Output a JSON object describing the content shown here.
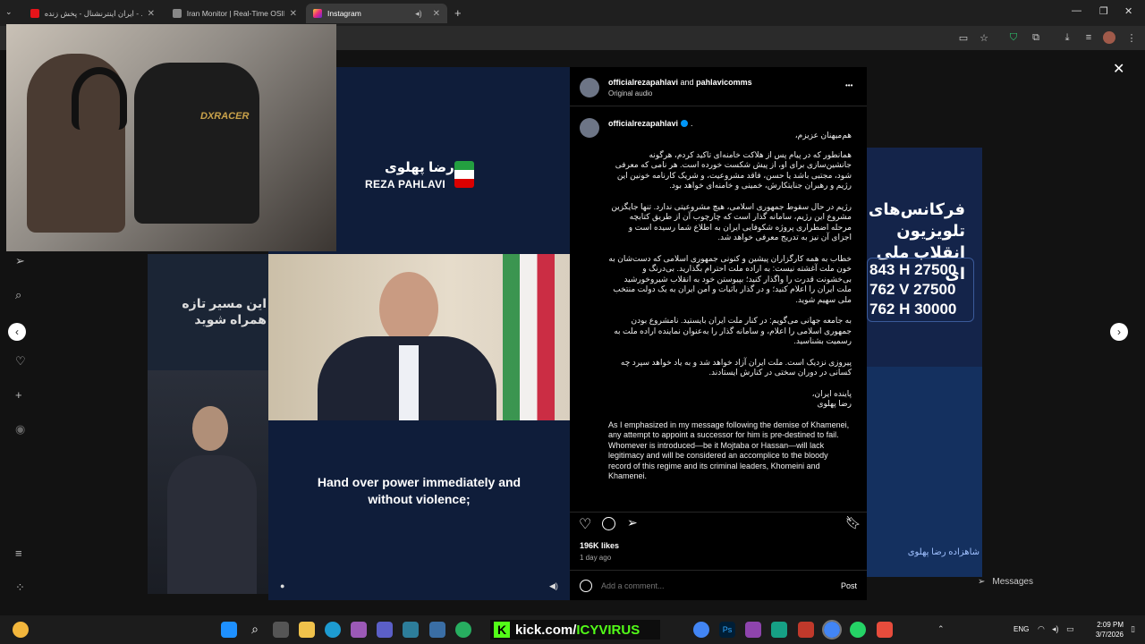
{
  "browser": {
    "tabs": [
      {
        "label": "ایران اینترنشنال - پخش زنده - ...be"
      },
      {
        "label": "Iran Monitor | Real-Time OSINT"
      },
      {
        "label": "Instagram"
      }
    ]
  },
  "video": {
    "logo_fa": "رضا پهلوی",
    "logo_en": "REZA PAHLAVI",
    "caption": "Hand over power immediately and without violence;"
  },
  "post": {
    "header": {
      "user1": "officialrezapahlavi",
      "and": "and",
      "user2": "pahlavicomms",
      "audio": "Original audio",
      "more": "•••"
    },
    "author": "officialrezapahlavi",
    "author_suffix": ".",
    "caption_fa": [
      "هم‌میهنان عزیزم،",
      "همانطور که در پیام پس از هلاکت خامنه‌ای تاکید کردم، هرگونه جانشین‌سازی برای او، از پیش شکست خورده است. هر نامی که معرفی شود، مجتبی باشد یا حسن، فاقد مشروعیت، و شریک کارنامه خونین این رژیم و رهبران جنایتکارش، خمینی و خامنه‌ای خواهد بود.",
      "رژیم در حال سقوط جمهوری اسلامی، هیچ مشروعیتی ندارد. تنها جایگزین مشروع این رژیم، سامانه گذار است که چارچوب آن از طریق کتابچه مرحله اضطراری پروژه شکوفایی ایران به اطلاع شما رسیده است و اجزای آن نیز به تدریج معرفی خواهد شد.",
      "خطاب به همه کارگزاران پیشین و کنونی جمهوری اسلامی که دست‌شان به خون ملت آغشته نیست: به اراده ملت احترام بگذارید. بی‌درنگ و بی‌خشونت قدرت را واگذار کنید؛ بپیوستن خود به انقلاب شیروخورشید ملت ایران را اعلام کنید؛ و در گذار باثبات و امن ایران به یک دولت منتخب ملی سهیم شوید.",
      "به جامعه جهانی می‌گویم: در کنار ملت ایران بایستید. نامشروع بودن جمهوری اسلامی را اعلام، و سامانه گذار را به‌عنوان نماینده اراده ملت به رسمیت بشناسید.",
      "پیروزی نزدیک است. ملت ایران آزاد خواهد شد و به یاد خواهد سپرد چه کسانی در دوران سختی در کنارش ایستادند.",
      "پاینده ایران،\nرضا پهلوی"
    ],
    "caption_en": "As I emphasized in my message following the demise of Khamenei, any attempt to appoint a successor for him is pre-destined to fail. Whomever is introduced—be it Mojtaba or Hassan—will lack legitimacy and will be considered an accomplice to the bloody record of this regime and its criminal leaders, Khomeini and Khamenei.",
    "likes": "196K likes",
    "time": "1 day ago",
    "comment_placeholder": "Add a comment...",
    "post_label": "Post"
  },
  "background": {
    "left_fa": "این مسیر تازه همراه شوید",
    "right_fa": "فرکانس‌های تلویزیون انقلاب ملی ای",
    "freqs": [
      "843 H 27500",
      "762 V 27500",
      "762 H 30000"
    ],
    "right_name": "شاهزاده رضا پهلوی",
    "messages": "Messages"
  },
  "webcam": {
    "chair_text": "DXRACER"
  },
  "taskbar": {
    "kick_prefix": "kick.com/",
    "kick_user": "ICYVIRUS",
    "lang": "ENG",
    "time": "2:09 PM",
    "date": "3/7/2026"
  },
  "colors": {
    "accent": "#0095f6",
    "kick": "#53fc18"
  }
}
